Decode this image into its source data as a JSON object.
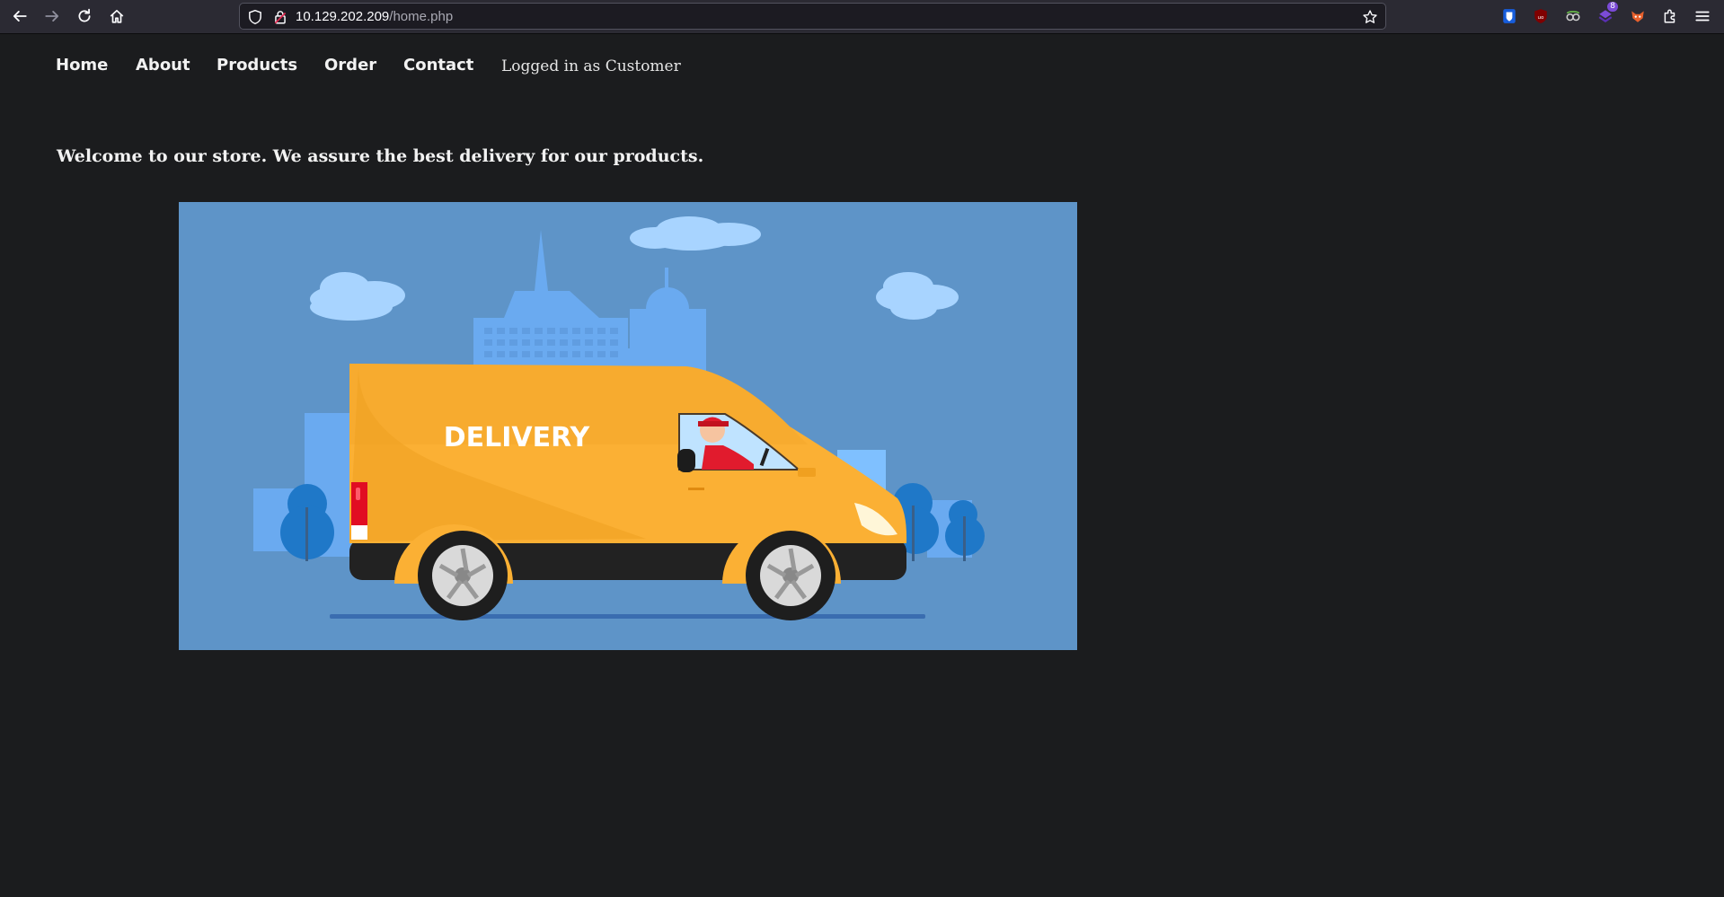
{
  "browser": {
    "url_host": "10.129.202.209",
    "url_path": "/home.php",
    "extensions": [
      {
        "name": "bitwarden-icon",
        "color": "#175ddc"
      },
      {
        "name": "ublock-icon",
        "color": "#800000"
      },
      {
        "name": "privacy-badger-icon",
        "color": "#cccccc"
      },
      {
        "name": "notification-extension-icon",
        "color": "#7b4bd6",
        "badge": "8"
      },
      {
        "name": "foxyproxy-icon",
        "color": "#e8602c"
      }
    ]
  },
  "nav": {
    "items": [
      "Home",
      "About",
      "Products",
      "Order",
      "Contact"
    ],
    "status": "Logged in as Customer"
  },
  "main": {
    "welcome": "Welcome to our store. We assure the best delivery for our products.",
    "hero_van_text": "DELIVERY"
  },
  "colors": {
    "page_bg": "#1b1c1e",
    "hero_sky": "#5e94c8",
    "van_body": "#fbb034"
  }
}
